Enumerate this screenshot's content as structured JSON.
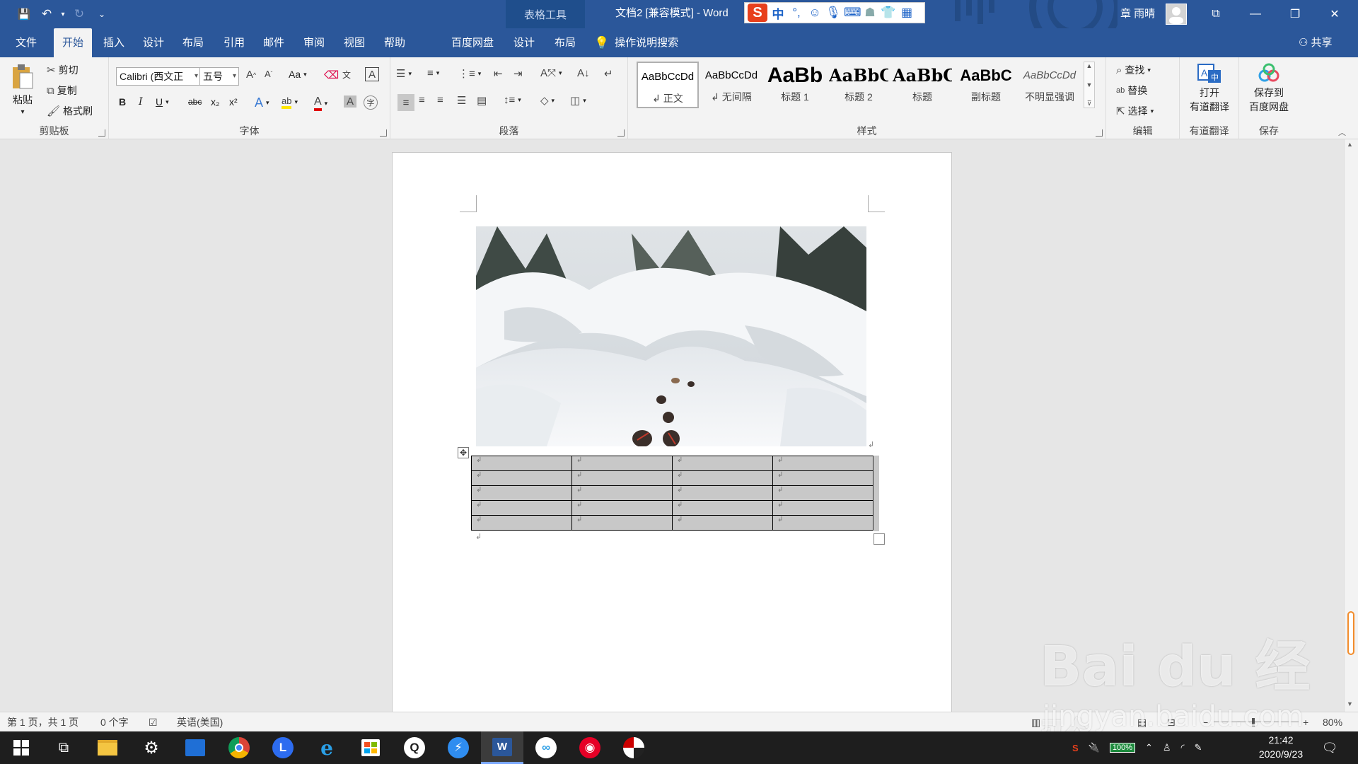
{
  "titlebar": {
    "qat_save": "💾",
    "qat_undo": "↶",
    "qat_redo": "↻",
    "qat_more": "⌄",
    "context_tools": "表格工具",
    "doc_title": "文档2 [兼容模式] - Word",
    "ime_logo": "S",
    "ime_mode": "中",
    "ime_punct": "°,",
    "ime_icons": [
      "smile-icon",
      "mic-icon",
      "keyboard-icon",
      "user-icon",
      "shirt-icon",
      "grid-icon"
    ],
    "user_name": "章 雨晴",
    "win_restore_ribbon": "⧉",
    "win_min": "—",
    "win_max": "❐",
    "win_close": "✕"
  },
  "tabs": [
    "文件",
    "开始",
    "插入",
    "设计",
    "布局",
    "引用",
    "邮件",
    "审阅",
    "视图",
    "帮助",
    "百度网盘",
    "设计",
    "布局"
  ],
  "active_tab": "开始",
  "tell_me": "操作说明搜索",
  "share": "共享",
  "ribbon": {
    "clipboard": {
      "label": "剪贴板",
      "paste": "粘贴",
      "cut": "剪切",
      "copy": "复制",
      "format_painter": "格式刷"
    },
    "font": {
      "label": "字体",
      "font_name": "Calibri (西文正",
      "font_size": "五号",
      "change_case": "Aa",
      "bold": "B",
      "italic": "I",
      "underline": "U",
      "strike": "abc",
      "sub": "x₂",
      "sup": "x²",
      "font_color_letter": "A",
      "highlight_letter": "ab"
    },
    "paragraph": {
      "label": "段落"
    },
    "styles": {
      "label": "样式",
      "items": [
        {
          "preview": "AaBbCcDd",
          "name": "↲ 正文"
        },
        {
          "preview": "AaBbCcDd",
          "name": "↲ 无间隔"
        },
        {
          "preview": "AaBb",
          "name": "标题 1"
        },
        {
          "preview": "AaBbC",
          "name": "标题 2"
        },
        {
          "preview": "AaBbC",
          "name": "标题"
        },
        {
          "preview": "AaBbC",
          "name": "副标题"
        },
        {
          "preview": "AaBbCcDd",
          "name": "不明显强调"
        }
      ]
    },
    "editing": {
      "label": "编辑",
      "find": "查找",
      "replace": "替换",
      "select": "选择"
    },
    "youdao": {
      "label": "有道翻译",
      "btn_line1": "打开",
      "btn_line2": "有道翻译"
    },
    "baidu_save": {
      "label": "保存",
      "btn_line1": "保存到",
      "btn_line2": "百度网盘"
    }
  },
  "document": {
    "table": {
      "rows": 5,
      "cols": 4,
      "cell_mark": "↲"
    },
    "para_mark": "↲"
  },
  "statusbar": {
    "page": "第 1 页，共 1 页",
    "words": "0 个字",
    "language": "英语(美国)",
    "zoom": "80%"
  },
  "taskbar": {
    "apps": [
      "start-icon",
      "task-view-icon",
      "file-explorer-icon",
      "settings-icon",
      "photos-icon",
      "chrome-icon",
      "lark-icon",
      "ie-icon",
      "store-icon",
      "search-app-icon",
      "feishu-icon",
      "word-icon",
      "baidu-netdisk-icon",
      "netease-music-icon",
      "media-icon"
    ],
    "battery": "100%",
    "time": "21:42",
    "date": "2020/9/23"
  },
  "watermark": {
    "line1": "Bai du 经验",
    "line2": "jingyan.baidu.com"
  },
  "colors": {
    "word_blue": "#2b579a",
    "ribbon_bg": "#f3f3f3",
    "taskbar": "#1e1e1e",
    "table_shade": "#c8c8c8"
  }
}
